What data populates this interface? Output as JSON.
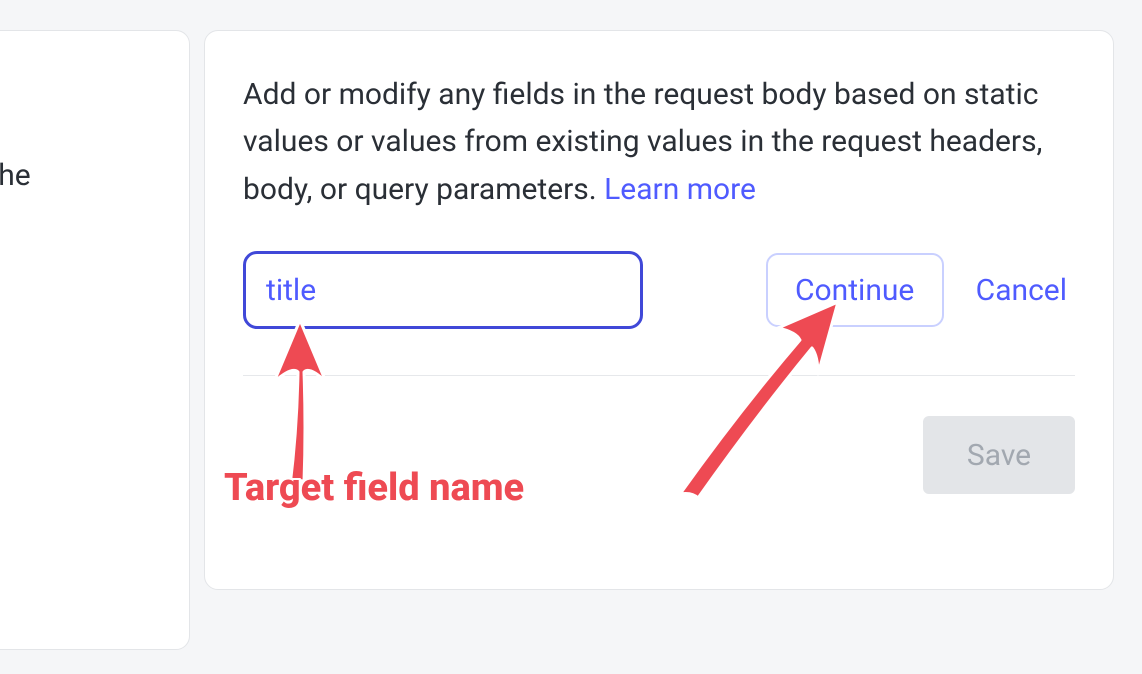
{
  "leftCard": {
    "fragment": "ey to the"
  },
  "mainCard": {
    "description": "Add or modify any fields in the request body based on static values or values from existing values in the request headers, body, or query parameters. ",
    "learnMore": "Learn more",
    "input": {
      "value": "title"
    },
    "continue": "Continue",
    "cancel": "Cancel",
    "save": "Save"
  },
  "annotations": {
    "targetFieldLabel": "Target field name"
  }
}
